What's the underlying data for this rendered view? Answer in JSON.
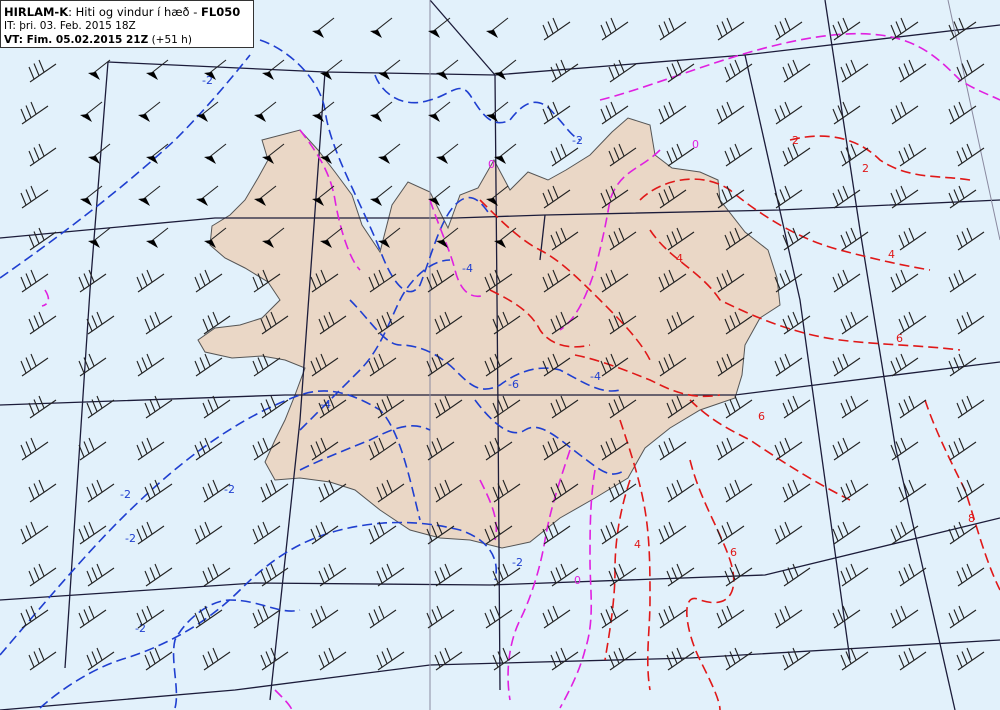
{
  "header": {
    "model": "HIRLAM-K",
    "sep": ": ",
    "description": "Hiti og vindur í hæð - ",
    "level": "FL050",
    "it_label": "IT: ",
    "it_value": "þri. 03. Feb. 2015 18Z",
    "vt_label": "VT: Fim. 05.02.2015 21Z",
    "vt_offset": " (+51 h)"
  },
  "colors": {
    "sea": "#e2f1fb",
    "land": "#ead7c6",
    "coast": "#555555",
    "grid": "#1c1c3a",
    "negative_isotherm": "#1f3fd0",
    "zero_isotherm": "#e020e0",
    "positive_isotherm": "#e01818",
    "barb": "#222222"
  },
  "isotherm_labels": [
    {
      "text": "-2",
      "color": "negative_isotherm"
    },
    {
      "text": "-2",
      "color": "negative_isotherm"
    },
    {
      "text": "-2",
      "color": "negative_isotherm"
    },
    {
      "text": "-2",
      "color": "negative_isotherm"
    },
    {
      "text": "-2",
      "color": "negative_isotherm"
    },
    {
      "text": "-2",
      "color": "negative_isotherm"
    },
    {
      "text": "-2",
      "color": "negative_isotherm"
    },
    {
      "text": "-4",
      "color": "negative_isotherm"
    },
    {
      "text": "-4",
      "color": "negative_isotherm"
    },
    {
      "text": "-4",
      "color": "negative_isotherm"
    },
    {
      "text": "-6",
      "color": "negative_isotherm"
    },
    {
      "text": "0",
      "color": "zero_isotherm"
    },
    {
      "text": "0",
      "color": "zero_isotherm"
    },
    {
      "text": "0",
      "color": "zero_isotherm"
    },
    {
      "text": "2",
      "color": "positive_isotherm"
    },
    {
      "text": "2",
      "color": "positive_isotherm"
    },
    {
      "text": "4",
      "color": "positive_isotherm"
    },
    {
      "text": "4",
      "color": "positive_isotherm"
    },
    {
      "text": "4",
      "color": "positive_isotherm"
    },
    {
      "text": "6",
      "color": "positive_isotherm"
    },
    {
      "text": "6",
      "color": "positive_isotherm"
    },
    {
      "text": "6",
      "color": "positive_isotherm"
    },
    {
      "text": "8",
      "color": "positive_isotherm"
    }
  ]
}
